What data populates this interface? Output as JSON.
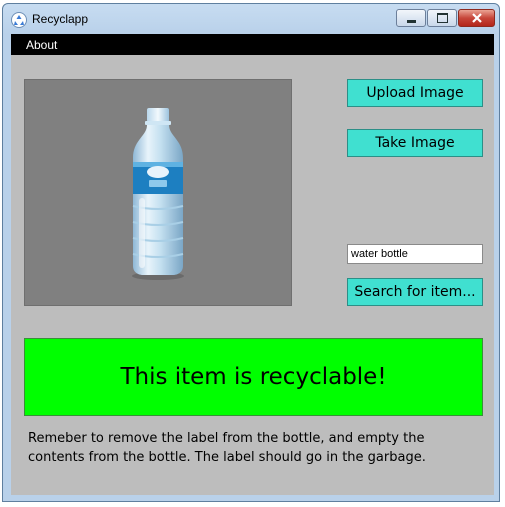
{
  "window": {
    "title": "Recyclapp",
    "icon": "recycle-icon",
    "controls": [
      "minimize-icon",
      "maximize-icon",
      "close-icon"
    ]
  },
  "menu": {
    "items": [
      {
        "label": "About"
      }
    ]
  },
  "image_panel": {
    "image": "water-bottle-photo"
  },
  "buttons": {
    "upload_label": "Upload Image",
    "take_label": "Take Image",
    "search_label": "Search for item..."
  },
  "search": {
    "value": "water bottle"
  },
  "result": {
    "text": "This item is recyclable!",
    "color": "#00ff00"
  },
  "instructions": {
    "text": "Remeber to remove the label from the bottle, and empty the contents from the bottle. The label should go in the garbage."
  },
  "colors": {
    "accent_button": "#40e0d0",
    "menubar": "#000000",
    "client_bg": "#bdbdbd"
  }
}
